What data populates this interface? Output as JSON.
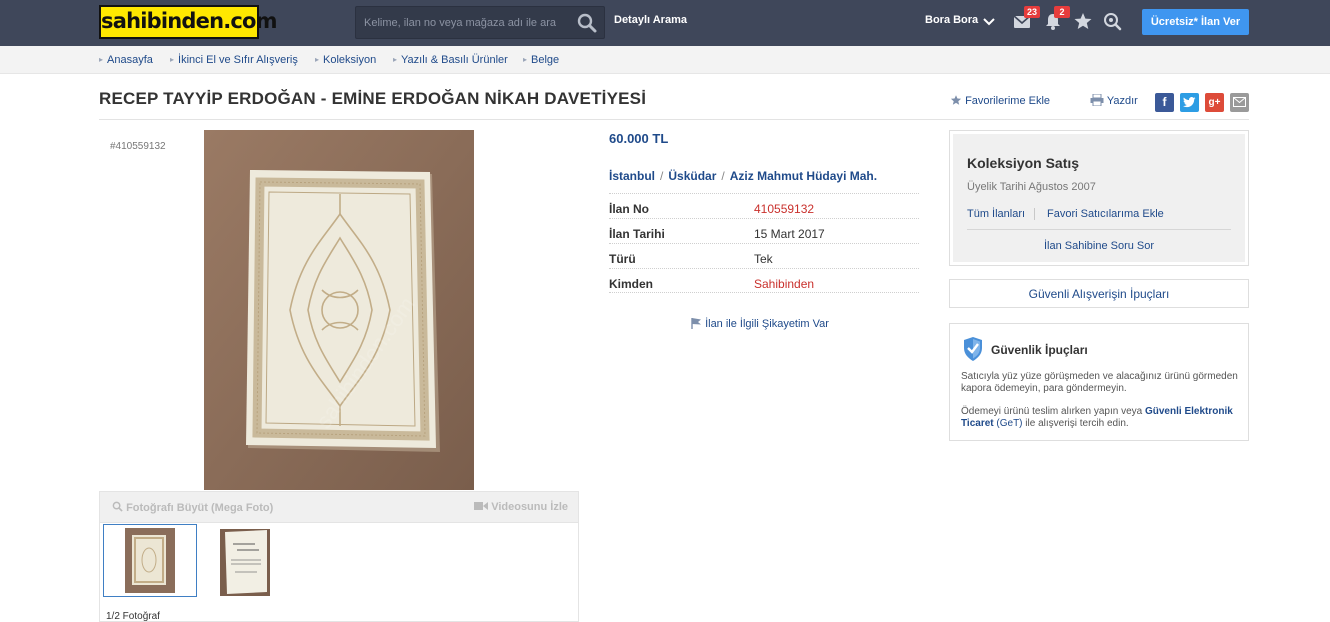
{
  "header": {
    "logo": "sahibinden.com",
    "search_placeholder": "Kelime, ilan no veya mağaza adı ile ara",
    "advanced_search": "Detaylı Arama",
    "user_name": "Bora Bora",
    "messages_count": "23",
    "notifications_count": "2",
    "post_button": "Ücretsiz* İlan Ver"
  },
  "breadcrumb": [
    "Anasayfa",
    "İkinci El ve Sıfır Alışveriş",
    "Koleksiyon",
    "Yazılı & Basılı Ürünler",
    "Belge"
  ],
  "listing": {
    "title": "RECEP TAYYİP ERDOĞAN - EMİNE ERDOĞAN NİKAH DAVETİYESİ",
    "id_label": "#410559132",
    "favorite_label": "Favorilerime Ekle",
    "print_label": "Yazdır",
    "price": "60.000 TL",
    "location": [
      "İstanbul",
      "Üsküdar",
      "Aziz Mahmut Hüdayi Mah."
    ],
    "info": [
      {
        "key": "İlan No",
        "value": "410559132"
      },
      {
        "key": "İlan Tarihi",
        "value": "15 Mart 2017"
      },
      {
        "key": "Türü",
        "value": "Tek"
      },
      {
        "key": "Kimden",
        "value": "Sahibinden"
      }
    ],
    "complaint": "İlan ile İlgili Şikayetim Var",
    "mega_photo": "Fotoğrafı Büyüt (Mega Foto)",
    "video": "Videosunu İzle",
    "photo_count": "1/2 Fotoğraf"
  },
  "seller": {
    "name": "Koleksiyon Satış",
    "since_label": "Üyelik Tarihi",
    "since_value": "Ağustos 2007",
    "all_listings": "Tüm İlanları",
    "add_fav_seller": "Favori Satıcılarıma Ekle",
    "ask": "İlan Sahibine Soru Sor"
  },
  "tips_button": "Güvenli Alışverişin İpuçları",
  "security": {
    "title": "Güvenlik İpuçları",
    "p1": "Satıcıyla yüz yüze görüşmeden ve alacağınız ürünü görmeden kapora ödemeyin, para göndermeyin.",
    "p2_prefix": "Ödemeyi ürünü teslim alırken yapın veya ",
    "p2_link": "Güvenli Elektronik Ticaret",
    "p2_link_abbr": "(GeT)",
    "p2_suffix": " ile alışverişi tercih edin."
  },
  "colors": {
    "header_bg": "#3f475a",
    "logo_bg": "#ffe800",
    "link": "#1f4a8a",
    "accent_red": "#c9302c",
    "post_button": "#3f96f0"
  }
}
